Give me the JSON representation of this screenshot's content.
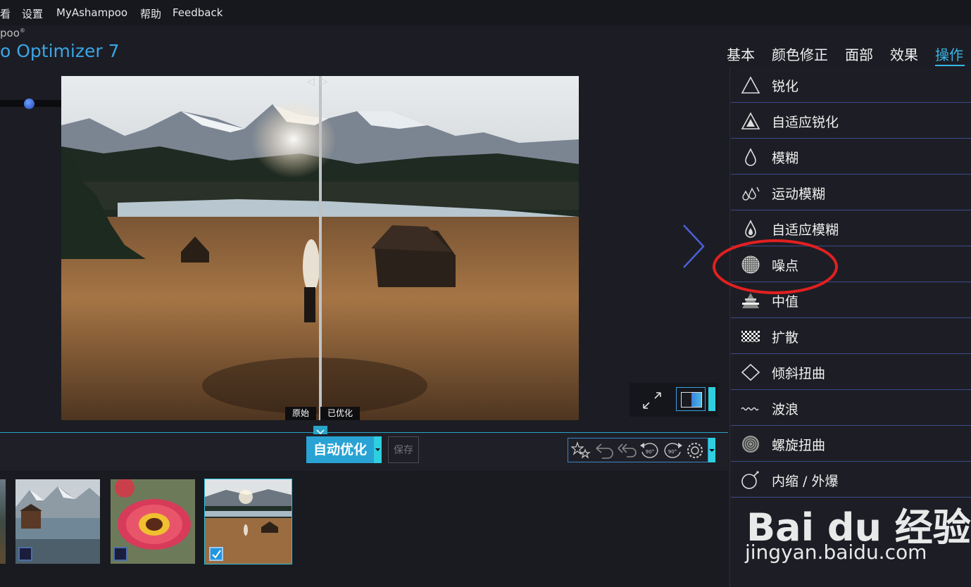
{
  "menu": {
    "items": [
      "看",
      "设置",
      "MyAshampoo",
      "帮助",
      "Feedback"
    ]
  },
  "app": {
    "brand": "poo",
    "brand_mark": "®",
    "title": "o Optimizer 7"
  },
  "category_tabs": [
    {
      "label": "基本"
    },
    {
      "label": "颜色修正"
    },
    {
      "label": "面部"
    },
    {
      "label": "效果"
    },
    {
      "label": "操作",
      "active": true
    }
  ],
  "operations": [
    {
      "label": "锐化",
      "icon": "triangle-outline-icon"
    },
    {
      "label": "自适应锐化",
      "icon": "triangle-filled-icon"
    },
    {
      "label": "模糊",
      "icon": "drop-icon"
    },
    {
      "label": "运动模糊",
      "icon": "motion-drops-icon"
    },
    {
      "label": "自适应模糊",
      "icon": "drop-filled-icon"
    },
    {
      "label": "噪点",
      "icon": "noise-ball-icon"
    },
    {
      "label": "中值",
      "icon": "pyramid-icon"
    },
    {
      "label": "扩散",
      "icon": "checker-icon"
    },
    {
      "label": "倾斜扭曲",
      "icon": "diamond-icon"
    },
    {
      "label": "波浪",
      "icon": "wave-icon"
    },
    {
      "label": "螺旋扭曲",
      "icon": "spiral-icon"
    },
    {
      "label": "内缩 / 外爆",
      "icon": "bomb-icon"
    }
  ],
  "compare": {
    "original": "原始",
    "optimized": "已优化"
  },
  "toolbar": {
    "auto_optimize": "自动优化",
    "save": "保存",
    "tools": [
      "magic-stars-icon",
      "undo-icon",
      "undo-all-icon",
      "rotate-left-90-icon",
      "rotate-right-90-icon",
      "settings-gear-icon"
    ],
    "rotate_label": "90°"
  },
  "thumbnails": [
    {
      "name": "lake-mountains",
      "checked": false
    },
    {
      "name": "red-flower",
      "checked": false
    },
    {
      "name": "meadow-woman",
      "checked": true,
      "selected": true
    }
  ],
  "watermark": {
    "text": "Bai du 经验",
    "url": "jingyan.baidu.com"
  },
  "colors": {
    "accent": "#38b6e8",
    "annotation": "#e02020",
    "background": "#1c1d24"
  }
}
